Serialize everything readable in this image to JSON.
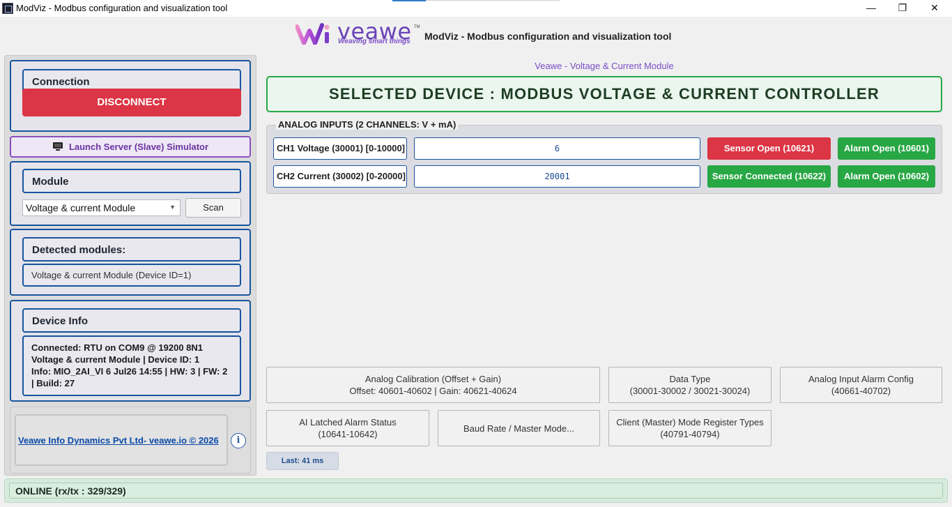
{
  "window": {
    "title": "ModViz - Modbus configuration and visualization tool",
    "minimize": "—",
    "maximize": "❐",
    "close": "✕"
  },
  "header": {
    "logo_word": "veawe",
    "logo_tagline": "Weaving smart things",
    "logo_tm": "TM",
    "title": "ModViz - Modbus configuration and visualization tool"
  },
  "connection": {
    "title": "Connection",
    "disconnect_label": "DISCONNECT"
  },
  "simulator": {
    "icon": "monitor-icon",
    "label": "Launch Server (Slave) Simulator"
  },
  "module": {
    "title": "Module",
    "selected": "Voltage & current Module",
    "scan_label": "Scan"
  },
  "detected": {
    "title": "Detected modules:",
    "item": "Voltage & current Module (Device ID=1)"
  },
  "device_info": {
    "title": "Device Info",
    "text": "Connected: RTU on COM9 @ 19200 8N1\nVoltage & current Module | Device ID: 1\nInfo: MIO_2AI_VI  6 Jul26 14:55 | HW: 3 | FW: 2\n| Build: 27"
  },
  "footer": {
    "company": "Veawe Info Dynamics Pvt Ltd- veawe.io © 2026",
    "info_icon": "i"
  },
  "main": {
    "module_caption": "Veawe - Voltage & Current Module",
    "selected_device": "SELECTED DEVICE : MODBUS VOLTAGE & CURRENT CONTROLLER",
    "ai_group_title": "ANALOG INPUTS (2 CHANNELS: V + mA)",
    "channels": [
      {
        "label": "CH1 Voltage (30001) [0-10000]",
        "value": "6",
        "sensor": "Sensor Open (10621)",
        "alarm": "Alarm Open (10601)"
      },
      {
        "label": "CH2 Current (30002) [0-20000]",
        "value": "20001",
        "sensor": "Sensor Connected (10622)",
        "alarm": "Alarm Open (10602)"
      }
    ],
    "actions": {
      "calibration": {
        "line1": "Analog Calibration (Offset + Gain)",
        "line2": "Offset: 40601-40602  |  Gain: 40621-40624"
      },
      "datatype": {
        "line1": "Data Type",
        "line2": "(30001-30002 / 30021-30024)"
      },
      "alarm_config": {
        "line1": "Analog Input Alarm Config",
        "line2": "(40661-40702)"
      },
      "latched": {
        "line1": "AI Latched Alarm Status",
        "line2": "(10641-10642)"
      },
      "baud": {
        "line1": "Baud Rate / Master Mode..."
      },
      "client_master": {
        "line1": "Client (Master) Mode Register Types",
        "line2": "(40791-40794)"
      }
    },
    "last_label": "Last: 41 ms"
  },
  "status": {
    "text": "ONLINE (rx/tx : 329/329)"
  },
  "colors": {
    "accent_blue": "#17549e",
    "danger_red": "#dc3545",
    "success_green": "#28a745",
    "brand_purple": "#7a4dc6"
  }
}
